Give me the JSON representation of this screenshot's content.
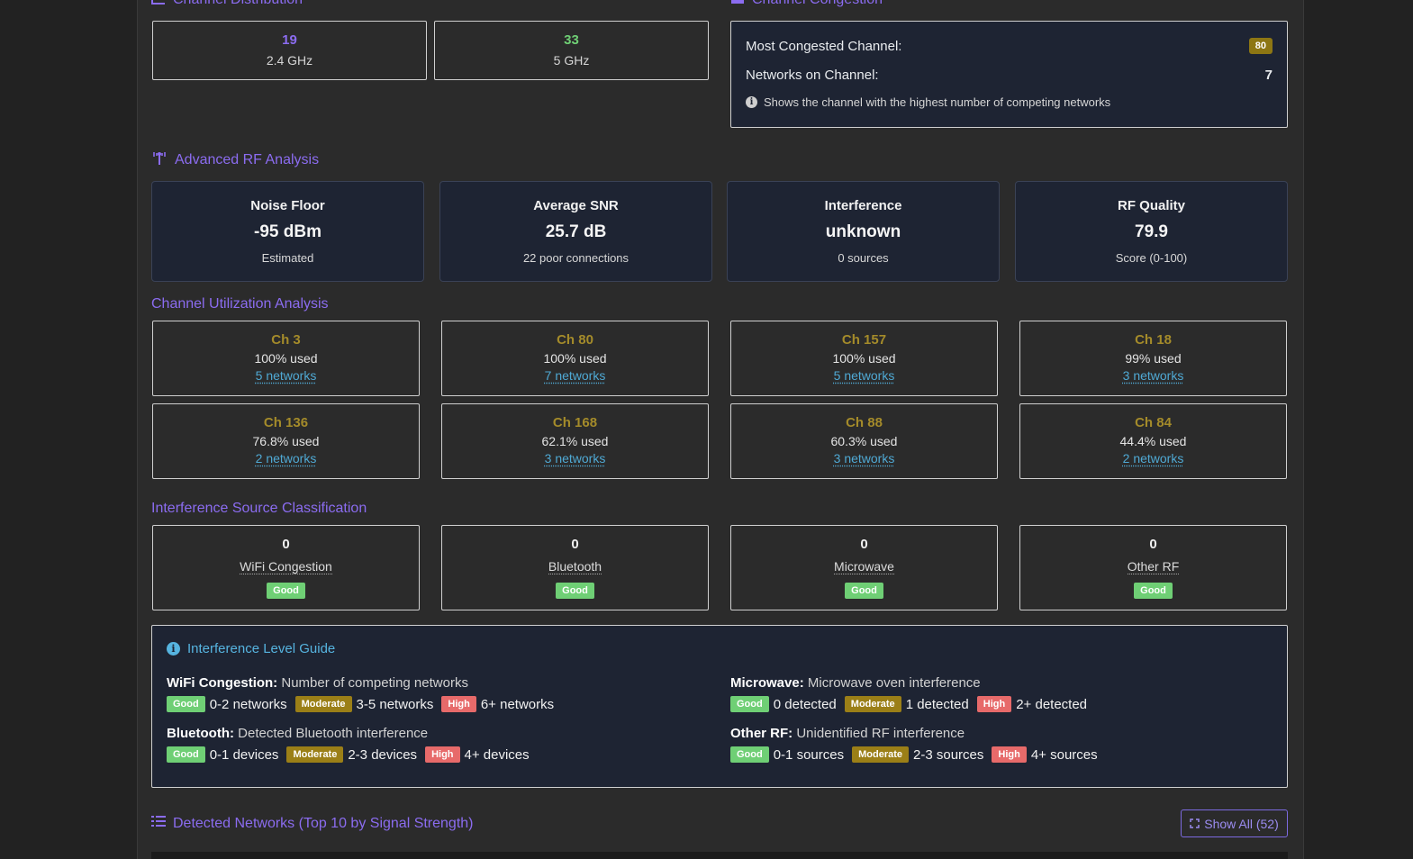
{
  "channel_distribution": {
    "title": "Channel Distribution",
    "bands": [
      {
        "count": "19",
        "label": "2.4 GHz",
        "color": "#8b6cf0"
      },
      {
        "count": "33",
        "label": "5 GHz",
        "color": "#6fcf75"
      }
    ]
  },
  "channel_congestion": {
    "title": "Channel Congestion",
    "most_label": "Most Congested Channel:",
    "most_value": "80",
    "networks_label": "Networks on Channel:",
    "networks_value": "7",
    "note": "Shows the channel with the highest number of competing networks"
  },
  "rf_analysis": {
    "title": "Advanced RF Analysis",
    "cards": [
      {
        "title": "Noise Floor",
        "value": "-95 dBm",
        "sub": "Estimated"
      },
      {
        "title": "Average SNR",
        "value": "25.7 dB",
        "sub": "22 poor connections"
      },
      {
        "title": "Interference",
        "value": "unknown",
        "sub": "0 sources"
      },
      {
        "title": "RF Quality",
        "value": "79.9",
        "sub": "Score (0-100)"
      }
    ]
  },
  "channel_utilization": {
    "title": "Channel Utilization Analysis",
    "channels": [
      {
        "name": "Ch 3",
        "used": "100% used",
        "networks": "5 networks"
      },
      {
        "name": "Ch 80",
        "used": "100% used",
        "networks": "7 networks"
      },
      {
        "name": "Ch 157",
        "used": "100% used",
        "networks": "5 networks"
      },
      {
        "name": "Ch 18",
        "used": "99% used",
        "networks": "3 networks"
      },
      {
        "name": "Ch 136",
        "used": "76.8% used",
        "networks": "2 networks"
      },
      {
        "name": "Ch 168",
        "used": "62.1% used",
        "networks": "3 networks"
      },
      {
        "name": "Ch 88",
        "used": "60.3% used",
        "networks": "3 networks"
      },
      {
        "name": "Ch 84",
        "used": "44.4% used",
        "networks": "2 networks"
      }
    ]
  },
  "interference_sources": {
    "title": "Interference Source Classification",
    "sources": [
      {
        "count": "0",
        "label": "WiFi Congestion",
        "status": "Good"
      },
      {
        "count": "0",
        "label": "Bluetooth",
        "status": "Good"
      },
      {
        "count": "0",
        "label": "Microwave",
        "status": "Good"
      },
      {
        "count": "0",
        "label": "Other RF",
        "status": "Good"
      }
    ]
  },
  "guide": {
    "title": "Interference Level Guide",
    "items": [
      {
        "name": "WiFi Congestion:",
        "desc": "Number of competing networks",
        "good": "Good",
        "good_text": "0-2 networks",
        "mod": "Moderate",
        "mod_text": "3-5 networks",
        "high": "High",
        "high_text": "6+ networks"
      },
      {
        "name": "Microwave:",
        "desc": "Microwave oven interference",
        "good": "Good",
        "good_text": "0 detected",
        "mod": "Moderate",
        "mod_text": "1 detected",
        "high": "High",
        "high_text": "2+ detected"
      },
      {
        "name": "Bluetooth:",
        "desc": "Detected Bluetooth interference",
        "good": "Good",
        "good_text": "0-1 devices",
        "mod": "Moderate",
        "mod_text": "2-3 devices",
        "high": "High",
        "high_text": "4+ devices"
      },
      {
        "name": "Other RF:",
        "desc": "Unidentified RF interference",
        "good": "Good",
        "good_text": "0-1 sources",
        "mod": "Moderate",
        "mod_text": "2-3 sources",
        "high": "High",
        "high_text": "4+ sources"
      }
    ]
  },
  "detected_networks": {
    "title": "Detected Networks (Top 10 by Signal Strength)",
    "show_all_label": "Show All (52)"
  },
  "colors": {
    "accent": "#8b6cf0",
    "channel_gold": "#a48b2a",
    "link_blue": "#4fa9d4",
    "good": "#6fcf75",
    "moderate": "#9b7f17",
    "high": "#e76a6a"
  }
}
